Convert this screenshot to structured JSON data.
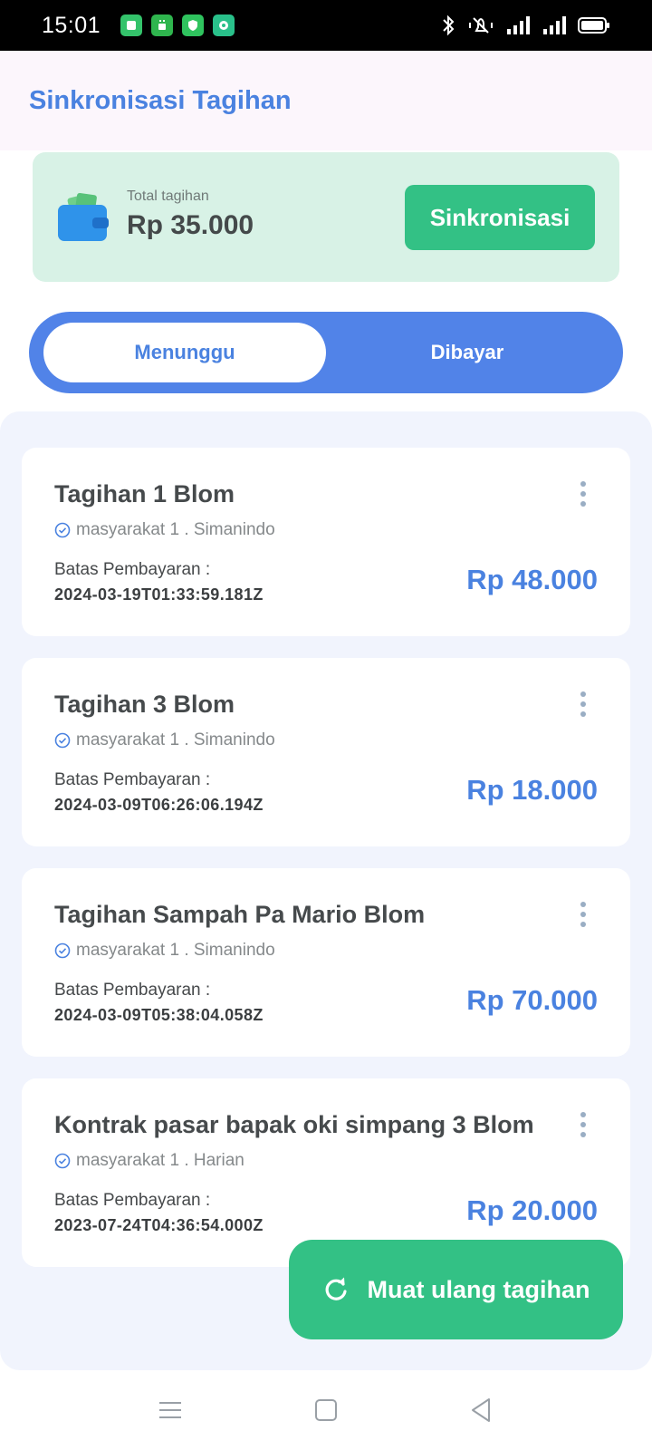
{
  "status_bar": {
    "time": "15:01",
    "notification_icons": [
      "app-icon",
      "app-icon",
      "shield-icon",
      "app-icon"
    ],
    "notification_colors": [
      "#34c36b",
      "#2fb54e",
      "#2fc35e",
      "#29c08a"
    ]
  },
  "header": {
    "title": "Sinkronisasi Tagihan"
  },
  "summary": {
    "total_label": "Total tagihan",
    "total_amount": "Rp 35.000",
    "sync_label": "Sinkronisasi"
  },
  "tabs": [
    {
      "label": "Menunggu",
      "active": true
    },
    {
      "label": "Dibayar",
      "active": false
    }
  ],
  "bills": [
    {
      "title": "Tagihan 1 Blom",
      "meta": "masyarakat 1 . Simanindo",
      "deadline_label": "Batas Pembayaran :",
      "deadline": "2024-03-19T01:33:59.181Z",
      "amount": "Rp 48.000"
    },
    {
      "title": "Tagihan 3 Blom",
      "meta": "masyarakat 1 . Simanindo",
      "deadline_label": "Batas Pembayaran :",
      "deadline": "2024-03-09T06:26:06.194Z",
      "amount": "Rp 18.000"
    },
    {
      "title": "Tagihan Sampah Pa Mario Blom",
      "meta": "masyarakat 1 . Simanindo",
      "deadline_label": "Batas Pembayaran :",
      "deadline": "2024-03-09T05:38:04.058Z",
      "amount": "Rp 70.000"
    },
    {
      "title": "Kontrak pasar bapak oki simpang 3 Blom",
      "meta": "masyarakat 1 . Harian",
      "deadline_label": "Batas Pembayaran :",
      "deadline": "2023-07-24T04:36:54.000Z",
      "amount": "Rp 20.000"
    }
  ],
  "fab": {
    "label": "Muat ulang tagihan"
  },
  "colors": {
    "accent_blue": "#4a82e0",
    "accent_green": "#33c185",
    "summary_bg": "#d8f2e6",
    "list_bg": "#f1f4fd"
  }
}
